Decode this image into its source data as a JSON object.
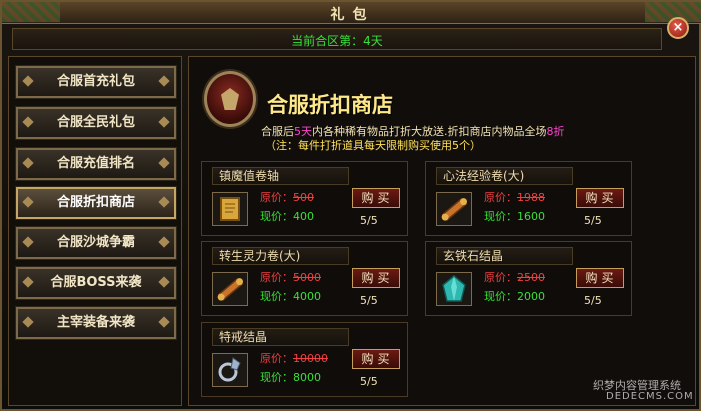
{
  "window": {
    "title": "礼包",
    "close_label": "×"
  },
  "header": {
    "server_day": "当前合区第：4天"
  },
  "sidebar": {
    "items": [
      {
        "label": "合服首充礼包"
      },
      {
        "label": "合服全民礼包"
      },
      {
        "label": "合服充值排名"
      },
      {
        "label": "合服折扣商店",
        "active": true
      },
      {
        "label": "合服沙城争霸"
      },
      {
        "label": "合服BOSS来袭"
      },
      {
        "label": "主宰装备来袭"
      }
    ]
  },
  "shop": {
    "title": "合服折扣商店",
    "desc_prefix": "合服后",
    "desc_days": "5天",
    "desc_middle": "内各种稀有物品打折大放送.折扣商店内物品全场",
    "desc_discount": "8折",
    "note": "（注：每件打折道具每天限制购买使用5个）",
    "items": [
      {
        "name": "镇魔值卷轴",
        "old_label": "原价：",
        "old_price": "500",
        "now_label": "现价：",
        "now_price": "400",
        "buy_label": "购买",
        "limit": "5/5",
        "icon": "scroll-icon"
      },
      {
        "name": "心法经验卷(大)",
        "old_label": "原价：",
        "old_price": "1988",
        "now_label": "现价：",
        "now_price": "1600",
        "buy_label": "购买",
        "limit": "5/5",
        "icon": "rolled-scroll-icon"
      },
      {
        "name": "转生灵力卷(大)",
        "old_label": "原价：",
        "old_price": "5000",
        "now_label": "现价：",
        "now_price": "4000",
        "buy_label": "购买",
        "limit": "5/5",
        "icon": "rolled-scroll-icon"
      },
      {
        "name": "玄铁石结晶",
        "old_label": "原价：",
        "old_price": "2500",
        "now_label": "现价：",
        "now_price": "2000",
        "buy_label": "购买",
        "limit": "5/5",
        "icon": "crystal-icon"
      },
      {
        "name": "特戒结晶",
        "old_label": "原价：",
        "old_price": "10000",
        "now_label": "现价：",
        "now_price": "8000",
        "buy_label": "购买",
        "limit": "5/5",
        "icon": "ring-crystal-icon"
      }
    ]
  },
  "watermark": {
    "line1": "织梦内容管理系统",
    "line2": "DEDECMS.COM"
  },
  "colors": {
    "accent_gold": "#ffe88a",
    "price_green": "#37e13a",
    "price_red": "#f04040",
    "highlight_pink": "#ff44d0"
  }
}
